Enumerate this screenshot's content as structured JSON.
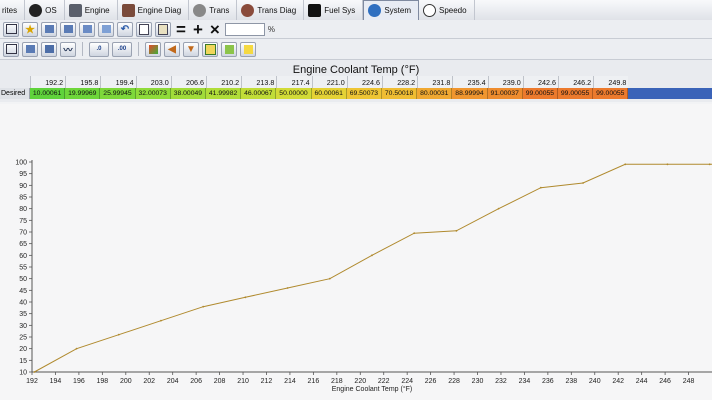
{
  "tabs": [
    {
      "label": "rites",
      "icon": "",
      "active": false
    },
    {
      "label": "OS",
      "icon": "chip-icon",
      "active": false
    },
    {
      "label": "Engine",
      "icon": "engine-icon",
      "active": false
    },
    {
      "label": "Engine Diag",
      "icon": "engine-diag-icon",
      "active": false
    },
    {
      "label": "Trans",
      "icon": "gear-icon",
      "active": false
    },
    {
      "label": "Trans Diag",
      "icon": "gear-diag-icon",
      "active": false
    },
    {
      "label": "Fuel Sys",
      "icon": "fuel-pump-icon",
      "active": false
    },
    {
      "label": "System",
      "icon": "globe-icon",
      "active": true
    },
    {
      "label": "Speedo",
      "icon": "speedometer-icon",
      "active": false
    }
  ],
  "toolbar": {
    "percent_symbol": "%",
    "equals_symbol": "=",
    "plus_symbol": "+",
    "times_symbol": "×",
    "decimal_more_label": ".0 .00",
    "decimal_less_label": ".00 .0"
  },
  "table": {
    "title": "Engine Coolant Temp (°F)",
    "row_label": "Desired",
    "columns": [
      "192.2",
      "195.8",
      "199.4",
      "203.0",
      "206.6",
      "210.2",
      "213.8",
      "217.4",
      "221.0",
      "224.6",
      "228.2",
      "231.8",
      "235.4",
      "239.0",
      "242.6",
      "246.2",
      "249.8"
    ],
    "values": [
      "10.00061",
      "19.99969",
      "25.99945",
      "32.00073",
      "38.00049",
      "41.99982",
      "46.00067",
      "50.00000",
      "60.00061",
      "69.50073",
      "70.50018",
      "80.00031",
      "88.99994",
      "91.00037",
      "99.00055",
      "99.00055",
      "99.00055"
    ],
    "cell_colors": [
      "#5fd33b",
      "#6ed63a",
      "#7ed83a",
      "#8fdb3a",
      "#a1dc39",
      "#b0dd39",
      "#c1dd38",
      "#d2db37",
      "#e4d236",
      "#eec534",
      "#efbd33",
      "#f0a831",
      "#f0962f",
      "#ee8c2e",
      "#ec7a2d",
      "#ec7a2d",
      "#ec7a2d"
    ]
  },
  "chart_data": {
    "type": "line",
    "title": "",
    "xlabel": "Engine Coolant Temp (°F)",
    "ylabel": "",
    "x": [
      192.2,
      195.8,
      199.4,
      203.0,
      206.6,
      210.2,
      213.8,
      217.4,
      221.0,
      224.6,
      228.2,
      231.8,
      235.4,
      239.0,
      242.6,
      246.2,
      249.8
    ],
    "series": [
      {
        "values": [
          10.00061,
          19.99969,
          25.99945,
          32.00073,
          38.00049,
          41.99982,
          46.00067,
          50.0,
          60.00061,
          69.50073,
          70.50018,
          80.00031,
          88.99994,
          91.00037,
          99.00055,
          99.00055,
          99.00055
        ]
      }
    ],
    "xlim": [
      192,
      250
    ],
    "ylim": [
      10,
      100
    ],
    "x_ticks": [
      192,
      194,
      196,
      198,
      200,
      202,
      204,
      206,
      208,
      210,
      212,
      214,
      216,
      218,
      220,
      222,
      224,
      226,
      228,
      230,
      232,
      234,
      236,
      238,
      240,
      242,
      244,
      246,
      248
    ],
    "y_ticks": [
      10,
      15,
      20,
      25,
      30,
      35,
      40,
      45,
      50,
      55,
      60,
      65,
      70,
      75,
      80,
      85,
      90,
      95,
      100
    ],
    "line_color": "#b08a2e",
    "grid": false
  }
}
